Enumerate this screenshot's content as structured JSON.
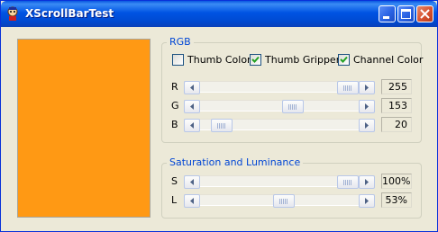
{
  "window": {
    "title": "XScrollBarTest"
  },
  "swatch": {
    "color": "#FF9914"
  },
  "rgb_group": {
    "label": "RGB",
    "checkboxes": [
      {
        "label": "Thumb Color",
        "checked": false
      },
      {
        "label": "Thumb Gripper",
        "checked": true
      },
      {
        "label": "Channel Color",
        "checked": true
      }
    ],
    "channels": [
      {
        "label": "R",
        "value": "255",
        "fraction": 1.0
      },
      {
        "label": "G",
        "value": "153",
        "fraction": 0.6
      },
      {
        "label": "B",
        "value": "20",
        "fraction": 0.08
      }
    ]
  },
  "sl_group": {
    "label": "Saturation and Luminance",
    "channels": [
      {
        "label": "S",
        "value": "100%",
        "fraction": 1.0
      },
      {
        "label": "L",
        "value": "53%",
        "fraction": 0.53
      }
    ]
  },
  "icons": {
    "app": "app-icon",
    "minimize": "minimize-icon",
    "maximize": "maximize-icon",
    "close": "close-icon",
    "left": "arrow-left-icon",
    "right": "arrow-right-icon",
    "check": "checkmark-icon"
  }
}
